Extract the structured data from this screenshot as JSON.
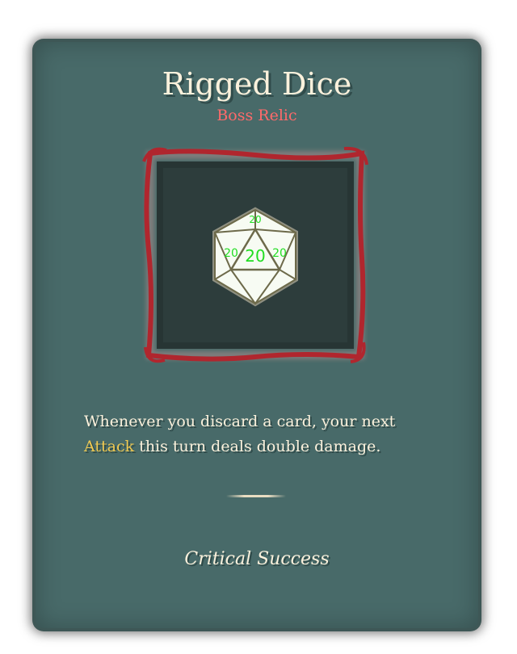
{
  "relic": {
    "name": "Rigged Dice",
    "tier": "Boss Relic",
    "description_before": "Whenever you discard a card, your next ",
    "keyword": "Attack",
    "description_after": " this turn deals double damage.",
    "flavor": "Critical Success",
    "die_face": "20"
  },
  "colors": {
    "card": "#486a69",
    "tier": "#ff6a6a",
    "keyword": "#efc851",
    "frame": "#b0262e",
    "die_numbers": "#22dd22"
  }
}
